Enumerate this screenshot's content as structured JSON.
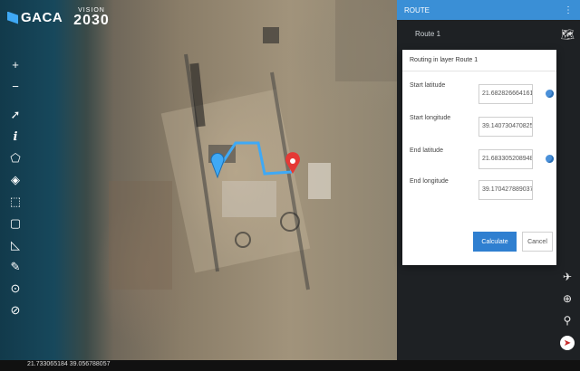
{
  "logo": {
    "brand": "GACA",
    "vision_label": "VISION",
    "vision_year": "2030"
  },
  "left_toolbar": {
    "items": [
      {
        "name": "zoom-in-button",
        "glyph": "+"
      },
      {
        "name": "zoom-out-button",
        "glyph": "−"
      },
      {
        "name": "select-tool-button",
        "glyph": "➚"
      },
      {
        "name": "info-tool-button",
        "glyph": "i"
      },
      {
        "name": "polygon-tool-button",
        "glyph": "⬠"
      },
      {
        "name": "fill-tool-button",
        "glyph": "◈"
      },
      {
        "name": "rectangle-tool-button",
        "glyph": "⬚"
      },
      {
        "name": "extent-tool-button",
        "glyph": "▢"
      },
      {
        "name": "measure-tool-button",
        "glyph": "◺"
      },
      {
        "name": "draw-tool-button",
        "glyph": "✎"
      },
      {
        "name": "compass-button",
        "glyph": "⊙"
      },
      {
        "name": "north-arrow-button",
        "glyph": "⊘"
      }
    ]
  },
  "status": {
    "coordinates": "21.733065184 39.056788057"
  },
  "panel": {
    "title": "ROUTE",
    "route_name": "Route 1"
  },
  "dialog": {
    "title": "Routing in layer Route 1",
    "fields": {
      "start_latitude": {
        "label": "Start latitude",
        "value": "21.6828266641615"
      },
      "start_longitude": {
        "label": "Start longitude",
        "value": "39.140730470825"
      },
      "end_latitude": {
        "label": "End latitude",
        "value": "21.6833052089489"
      },
      "end_longitude": {
        "label": "End longitude",
        "value": "39.1704278890378"
      }
    },
    "calculate_label": "Calculate",
    "cancel_label": "Cancel"
  },
  "colors": {
    "header": "#3a8fd6",
    "route_line": "#3fa9f5",
    "end_marker": "#e53935",
    "calculate_button": "#2f7fd0"
  }
}
